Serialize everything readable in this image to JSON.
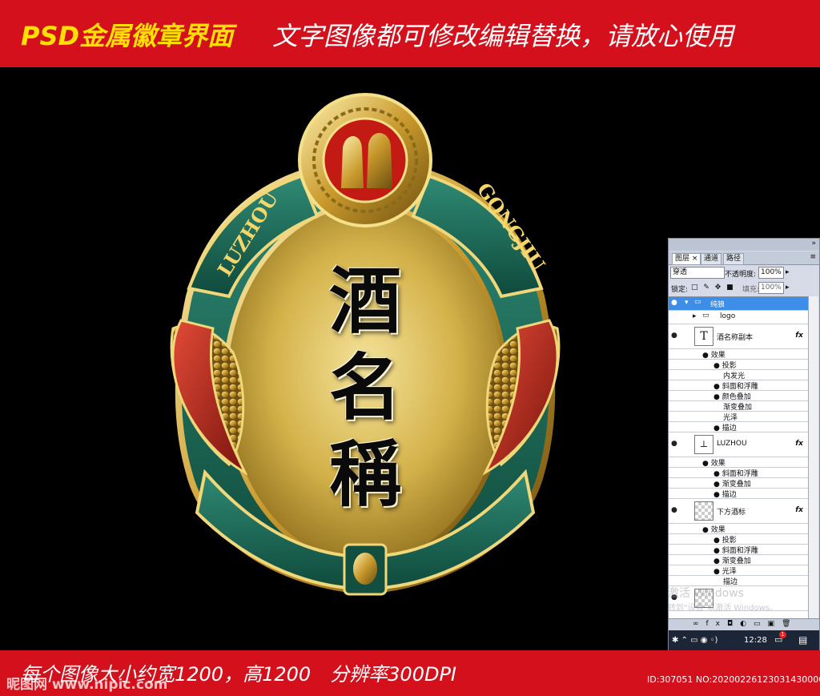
{
  "banner_top": {
    "left_text": "PSD金属徽章界面",
    "right_text": "文字图像都可修改编辑替换，请放心使用"
  },
  "badge": {
    "title_chars": [
      "酒",
      "名",
      "稱"
    ],
    "ribbon_left": "LUZHOU",
    "ribbon_right": "GONGJIU"
  },
  "banner_bottom": {
    "text": "每个图像大小约宽1200，高1200　分辨率300DPI",
    "watermark_left": "昵图网 www.nipic.com",
    "watermark_right": "ID:307051 NO:20200226123031430000"
  },
  "ps_panel": {
    "tabs": [
      "图层",
      "通道",
      "路径"
    ],
    "blend_mode": "穿透",
    "opacity_label": "不透明度:",
    "opacity_value": "100%",
    "lock_label": "锁定:",
    "fill_label": "填充:",
    "fill_value": "100%",
    "layers": [
      {
        "name": "纯狼",
        "type": "group",
        "selected": true
      },
      {
        "name": "logo",
        "type": "group"
      },
      {
        "name": "酒名称副本",
        "type": "text",
        "fx": "fx"
      },
      {
        "name": "效果",
        "type": "effects"
      },
      {
        "name": "投影",
        "type": "effect"
      },
      {
        "name": "内发光",
        "type": "effect"
      },
      {
        "name": "斜面和浮雕",
        "type": "effect"
      },
      {
        "name": "颜色叠加",
        "type": "effect"
      },
      {
        "name": "渐变叠加",
        "type": "effect"
      },
      {
        "name": "光泽",
        "type": "effect"
      },
      {
        "name": "描边",
        "type": "effect"
      },
      {
        "name": "LUZHOU",
        "type": "text2",
        "fx": "fx"
      },
      {
        "name": "效果",
        "type": "effects"
      },
      {
        "name": "斜面和浮雕",
        "type": "effect"
      },
      {
        "name": "渐变叠加",
        "type": "effect"
      },
      {
        "name": "描边",
        "type": "effect"
      },
      {
        "name": "下方酒标",
        "type": "image",
        "fx": "fx"
      },
      {
        "name": "效果",
        "type": "effects"
      },
      {
        "name": "投影",
        "type": "effect"
      },
      {
        "name": "斜面和浮雕",
        "type": "effect"
      },
      {
        "name": "渐变叠加",
        "type": "effect"
      },
      {
        "name": "光泽",
        "type": "effect"
      },
      {
        "name": "描边",
        "type": "effect"
      }
    ],
    "win_watermark_1": "激活 Windows",
    "win_watermark_2": "转到\"设置\"以激活 Windows。",
    "clock": "12:28",
    "notify_count": "1"
  },
  "colors": {
    "banner_red": "#d3101b",
    "banner_yellow": "#ffe000",
    "gold": "#d4b24a",
    "green": "#1d6e5c",
    "ribbon_red": "#b8241c",
    "panel_selected": "#3c8ee8"
  }
}
